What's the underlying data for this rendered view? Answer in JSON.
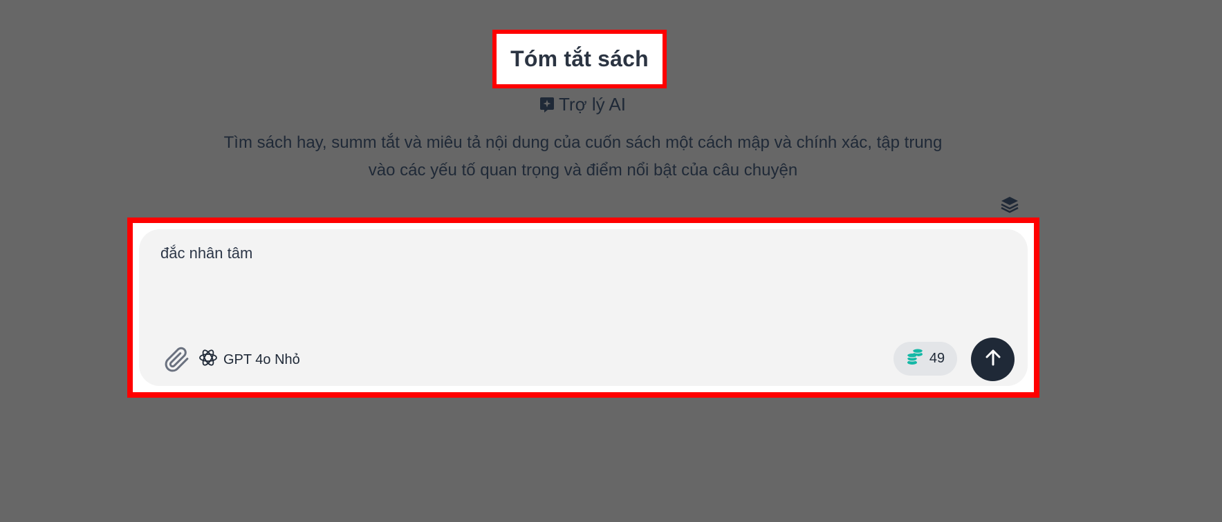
{
  "header": {
    "title": "Tóm tắt sách",
    "assistant_label": "Trợ lý AI",
    "description_line1": "Tìm sách hay, summ tắt và miêu tả nội dung của cuốn sách một cách mập và chính xác, tập trung",
    "description_line2": "vào các yếu tố quan trọng và điểm nổi bật của câu chuyện"
  },
  "composer": {
    "prompt_value": "đắc nhân tâm",
    "model_label": "GPT 4o Nhỏ",
    "credits_count": "49"
  },
  "icons": {
    "assistant": "sparkle-bubble-icon",
    "layers": "layers-icon",
    "attach": "paperclip-icon",
    "model": "openai-logo-icon",
    "credits": "coins-icon",
    "send": "arrow-up-icon"
  },
  "colors": {
    "background": "#676767",
    "highlight": "#ff0000",
    "send_button": "#1f2937",
    "coins": "#14b8a6"
  }
}
